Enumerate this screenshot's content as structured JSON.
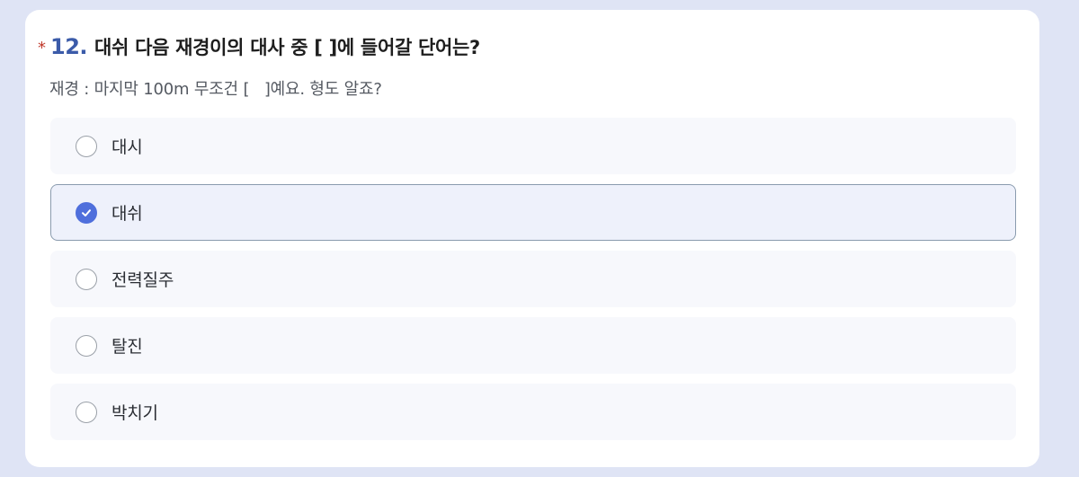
{
  "question": {
    "required_mark": "*",
    "number": "12.",
    "text": "대쉬 다음 재경이의 대사 중 [ ]에 들어갈 단어는?",
    "subtext": "재경 : 마지막 100m 무조건 [   ]예요. 형도 알죠?"
  },
  "options": [
    {
      "label": "대시",
      "selected": false
    },
    {
      "label": "대쉬",
      "selected": true
    },
    {
      "label": "전력질주",
      "selected": false
    },
    {
      "label": "탈진",
      "selected": false
    },
    {
      "label": "박치기",
      "selected": false
    }
  ],
  "colors": {
    "accent": "#4f6fdc",
    "question_number": "#3b5ba9",
    "required": "#c0392b",
    "page_background": "#dfe4f5"
  },
  "icons": {
    "selected": "check-icon",
    "unselected": "radio-empty-icon"
  }
}
